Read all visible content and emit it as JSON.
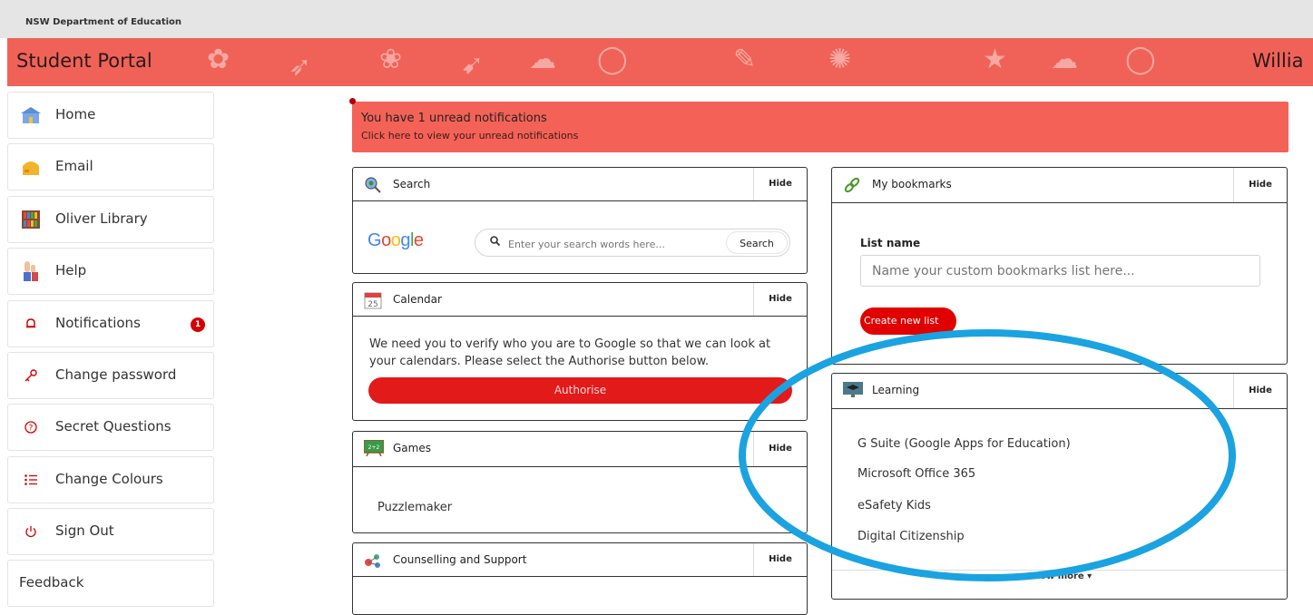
{
  "topbar": {
    "department": "NSW Department of Education"
  },
  "header": {
    "title": "Student Portal",
    "user": "Willia",
    "color": "#f06257"
  },
  "sidebar": {
    "items": [
      {
        "label": "Home",
        "icon": "school-house-icon"
      },
      {
        "label": "Email",
        "icon": "mailbox-icon"
      },
      {
        "label": "Oliver Library",
        "icon": "bookshelf-icon"
      },
      {
        "label": "Help",
        "icon": "raised-hand-icon"
      },
      {
        "label": "Notifications",
        "icon": "bell-icon",
        "badge": "1"
      },
      {
        "label": "Change password",
        "icon": "key-icon"
      },
      {
        "label": "Secret Questions",
        "icon": "question-circle-icon"
      },
      {
        "label": "Change Colours",
        "icon": "list-icon"
      },
      {
        "label": "Sign Out",
        "icon": "power-icon"
      },
      {
        "label": "Feedback"
      }
    ]
  },
  "notification": {
    "line1": "You have 1 unread notifications",
    "line2": "Click here to view your unread notifications"
  },
  "panels": {
    "hide_label": "Hide",
    "search": {
      "title": "Search",
      "logo": "Google",
      "placeholder": "Enter your search words here...",
      "button": "Search"
    },
    "calendar": {
      "title": "Calendar",
      "icon_text": "25",
      "message": "We need you to verify who you are to Google so that we can look at your calendars. Please select the Authorise button below.",
      "button": "Authorise"
    },
    "games": {
      "title": "Games",
      "items": [
        "Puzzlemaker"
      ]
    },
    "counselling": {
      "title": "Counselling and Support"
    },
    "bookmarks": {
      "title": "My bookmarks",
      "list_label": "List name",
      "list_placeholder": "Name your custom bookmarks list here...",
      "create_button": "Create new list"
    },
    "learning": {
      "title": "Learning",
      "items": [
        "G Suite (Google Apps for Education)",
        "Microsoft Office 365",
        "eSafety Kids",
        "Digital Citizenship"
      ],
      "show_more": "Show more ▾"
    }
  },
  "annotation": {
    "color": "#1aa3e0"
  }
}
